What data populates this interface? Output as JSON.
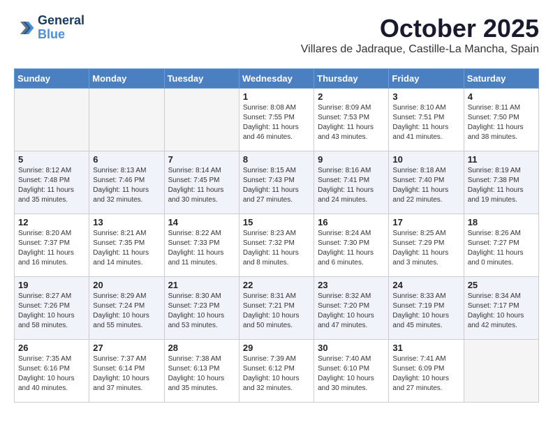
{
  "header": {
    "logo_line1": "General",
    "logo_line2": "Blue",
    "month_year": "October 2025",
    "location": "Villares de Jadraque, Castille-La Mancha, Spain"
  },
  "weekdays": [
    "Sunday",
    "Monday",
    "Tuesday",
    "Wednesday",
    "Thursday",
    "Friday",
    "Saturday"
  ],
  "weeks": [
    [
      {
        "day": "",
        "empty": true
      },
      {
        "day": "",
        "empty": true
      },
      {
        "day": "",
        "empty": true
      },
      {
        "day": "1",
        "sunrise": "8:08 AM",
        "sunset": "7:55 PM",
        "daylight": "11 hours and 46 minutes."
      },
      {
        "day": "2",
        "sunrise": "8:09 AM",
        "sunset": "7:53 PM",
        "daylight": "11 hours and 43 minutes."
      },
      {
        "day": "3",
        "sunrise": "8:10 AM",
        "sunset": "7:51 PM",
        "daylight": "11 hours and 41 minutes."
      },
      {
        "day": "4",
        "sunrise": "8:11 AM",
        "sunset": "7:50 PM",
        "daylight": "11 hours and 38 minutes."
      }
    ],
    [
      {
        "day": "5",
        "sunrise": "8:12 AM",
        "sunset": "7:48 PM",
        "daylight": "11 hours and 35 minutes."
      },
      {
        "day": "6",
        "sunrise": "8:13 AM",
        "sunset": "7:46 PM",
        "daylight": "11 hours and 32 minutes."
      },
      {
        "day": "7",
        "sunrise": "8:14 AM",
        "sunset": "7:45 PM",
        "daylight": "11 hours and 30 minutes."
      },
      {
        "day": "8",
        "sunrise": "8:15 AM",
        "sunset": "7:43 PM",
        "daylight": "11 hours and 27 minutes."
      },
      {
        "day": "9",
        "sunrise": "8:16 AM",
        "sunset": "7:41 PM",
        "daylight": "11 hours and 24 minutes."
      },
      {
        "day": "10",
        "sunrise": "8:18 AM",
        "sunset": "7:40 PM",
        "daylight": "11 hours and 22 minutes."
      },
      {
        "day": "11",
        "sunrise": "8:19 AM",
        "sunset": "7:38 PM",
        "daylight": "11 hours and 19 minutes."
      }
    ],
    [
      {
        "day": "12",
        "sunrise": "8:20 AM",
        "sunset": "7:37 PM",
        "daylight": "11 hours and 16 minutes."
      },
      {
        "day": "13",
        "sunrise": "8:21 AM",
        "sunset": "7:35 PM",
        "daylight": "11 hours and 14 minutes."
      },
      {
        "day": "14",
        "sunrise": "8:22 AM",
        "sunset": "7:33 PM",
        "daylight": "11 hours and 11 minutes."
      },
      {
        "day": "15",
        "sunrise": "8:23 AM",
        "sunset": "7:32 PM",
        "daylight": "11 hours and 8 minutes."
      },
      {
        "day": "16",
        "sunrise": "8:24 AM",
        "sunset": "7:30 PM",
        "daylight": "11 hours and 6 minutes."
      },
      {
        "day": "17",
        "sunrise": "8:25 AM",
        "sunset": "7:29 PM",
        "daylight": "11 hours and 3 minutes."
      },
      {
        "day": "18",
        "sunrise": "8:26 AM",
        "sunset": "7:27 PM",
        "daylight": "11 hours and 0 minutes."
      }
    ],
    [
      {
        "day": "19",
        "sunrise": "8:27 AM",
        "sunset": "7:26 PM",
        "daylight": "10 hours and 58 minutes."
      },
      {
        "day": "20",
        "sunrise": "8:29 AM",
        "sunset": "7:24 PM",
        "daylight": "10 hours and 55 minutes."
      },
      {
        "day": "21",
        "sunrise": "8:30 AM",
        "sunset": "7:23 PM",
        "daylight": "10 hours and 53 minutes."
      },
      {
        "day": "22",
        "sunrise": "8:31 AM",
        "sunset": "7:21 PM",
        "daylight": "10 hours and 50 minutes."
      },
      {
        "day": "23",
        "sunrise": "8:32 AM",
        "sunset": "7:20 PM",
        "daylight": "10 hours and 47 minutes."
      },
      {
        "day": "24",
        "sunrise": "8:33 AM",
        "sunset": "7:19 PM",
        "daylight": "10 hours and 45 minutes."
      },
      {
        "day": "25",
        "sunrise": "8:34 AM",
        "sunset": "7:17 PM",
        "daylight": "10 hours and 42 minutes."
      }
    ],
    [
      {
        "day": "26",
        "sunrise": "7:35 AM",
        "sunset": "6:16 PM",
        "daylight": "10 hours and 40 minutes."
      },
      {
        "day": "27",
        "sunrise": "7:37 AM",
        "sunset": "6:14 PM",
        "daylight": "10 hours and 37 minutes."
      },
      {
        "day": "28",
        "sunrise": "7:38 AM",
        "sunset": "6:13 PM",
        "daylight": "10 hours and 35 minutes."
      },
      {
        "day": "29",
        "sunrise": "7:39 AM",
        "sunset": "6:12 PM",
        "daylight": "10 hours and 32 minutes."
      },
      {
        "day": "30",
        "sunrise": "7:40 AM",
        "sunset": "6:10 PM",
        "daylight": "10 hours and 30 minutes."
      },
      {
        "day": "31",
        "sunrise": "7:41 AM",
        "sunset": "6:09 PM",
        "daylight": "10 hours and 27 minutes."
      },
      {
        "day": "",
        "empty": true
      }
    ]
  ]
}
